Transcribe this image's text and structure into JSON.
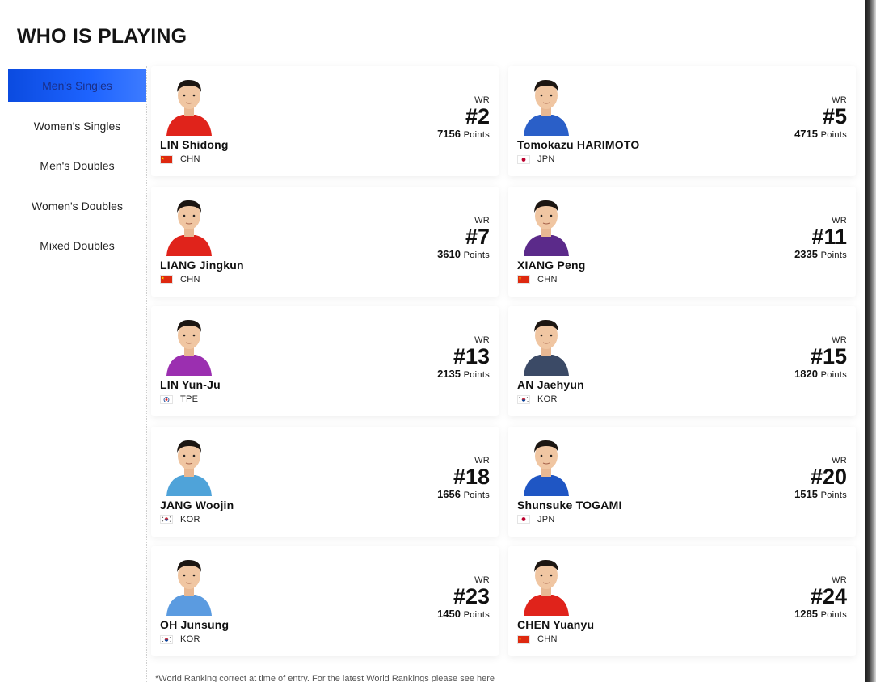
{
  "title": "WHO IS PLAYING",
  "sidebar": {
    "items": [
      {
        "label": "Men's Singles"
      },
      {
        "label": "Women's Singles"
      },
      {
        "label": "Men's Doubles"
      },
      {
        "label": "Women's Doubles"
      },
      {
        "label": "Mixed Doubles"
      }
    ]
  },
  "players": [
    {
      "name": "LIN Shidong",
      "country": "CHN",
      "flag": "chn",
      "wr_label": "WR",
      "rank": "#2",
      "points": "7156",
      "points_label": "Points",
      "shirt": "#e0231b"
    },
    {
      "name": "Tomokazu HARIMOTO",
      "country": "JPN",
      "flag": "jpn",
      "wr_label": "WR",
      "rank": "#5",
      "points": "4715",
      "points_label": "Points",
      "shirt": "#2a5fc8"
    },
    {
      "name": "LIANG Jingkun",
      "country": "CHN",
      "flag": "chn",
      "wr_label": "WR",
      "rank": "#7",
      "points": "3610",
      "points_label": "Points",
      "shirt": "#e0231b"
    },
    {
      "name": "XIANG Peng",
      "country": "CHN",
      "flag": "chn",
      "wr_label": "WR",
      "rank": "#11",
      "points": "2335",
      "points_label": "Points",
      "shirt": "#5b2a8a"
    },
    {
      "name": "LIN Yun-Ju",
      "country": "TPE",
      "flag": "tpe",
      "wr_label": "WR",
      "rank": "#13",
      "points": "2135",
      "points_label": "Points",
      "shirt": "#9b2fb0"
    },
    {
      "name": "AN Jaehyun",
      "country": "KOR",
      "flag": "kor",
      "wr_label": "WR",
      "rank": "#15",
      "points": "1820",
      "points_label": "Points",
      "shirt": "#3b4a66"
    },
    {
      "name": "JANG Woojin",
      "country": "KOR",
      "flag": "kor",
      "wr_label": "WR",
      "rank": "#18",
      "points": "1656",
      "points_label": "Points",
      "shirt": "#4fa3d9"
    },
    {
      "name": "Shunsuke TOGAMI",
      "country": "JPN",
      "flag": "jpn",
      "wr_label": "WR",
      "rank": "#20",
      "points": "1515",
      "points_label": "Points",
      "shirt": "#1f56c4"
    },
    {
      "name": "OH Junsung",
      "country": "KOR",
      "flag": "kor",
      "wr_label": "WR",
      "rank": "#23",
      "points": "1450",
      "points_label": "Points",
      "shirt": "#5b9be0"
    },
    {
      "name": "CHEN Yuanyu",
      "country": "CHN",
      "flag": "chn",
      "wr_label": "WR",
      "rank": "#24",
      "points": "1285",
      "points_label": "Points",
      "shirt": "#e0231b"
    }
  ],
  "footnote": {
    "text": "*World Ranking correct at time of entry. For the latest World Rankings please see ",
    "link": "here"
  },
  "colors": {
    "accent": "#1e64ff"
  }
}
